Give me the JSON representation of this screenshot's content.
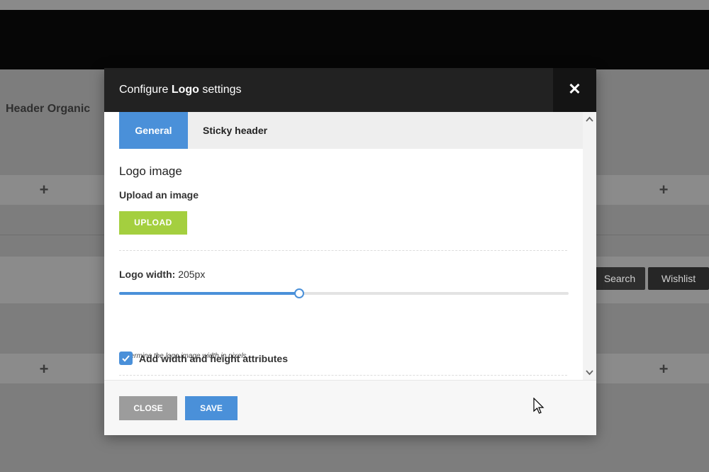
{
  "background": {
    "section_title": "Header Organic",
    "plus_symbol": "+",
    "buttons": {
      "search": "Search",
      "wishlist": "Wishlist"
    }
  },
  "modal": {
    "title_prefix": "Configure ",
    "title_bold": "Logo",
    "title_suffix": " settings",
    "close_glyph": "✕",
    "tabs": [
      {
        "label": "General",
        "active": true
      },
      {
        "label": "Sticky header",
        "active": false
      }
    ],
    "logo_image": {
      "heading": "Logo image",
      "upload_label": "Upload an image",
      "upload_button": "UPLOAD"
    },
    "logo_width": {
      "label": "Logo width:",
      "value_text": " 205px",
      "value": 205,
      "fraction": 0.4,
      "helper": "Determine the logo image width in pixels."
    },
    "attributes": {
      "checked": true,
      "label": "Add width and height attributes"
    },
    "footer": {
      "close": "CLOSE",
      "save": "SAVE"
    }
  },
  "colors": {
    "accent": "#4a90d9",
    "upload": "#a4cf3f",
    "close_button": "#9c9c9c",
    "header": "#222222"
  },
  "icons": {
    "close": "close-icon",
    "scroll_up": "chevron-up-icon",
    "scroll_down": "chevron-down-icon",
    "checkbox": "checkmark-icon",
    "cursor": "mouse-pointer-icon"
  }
}
